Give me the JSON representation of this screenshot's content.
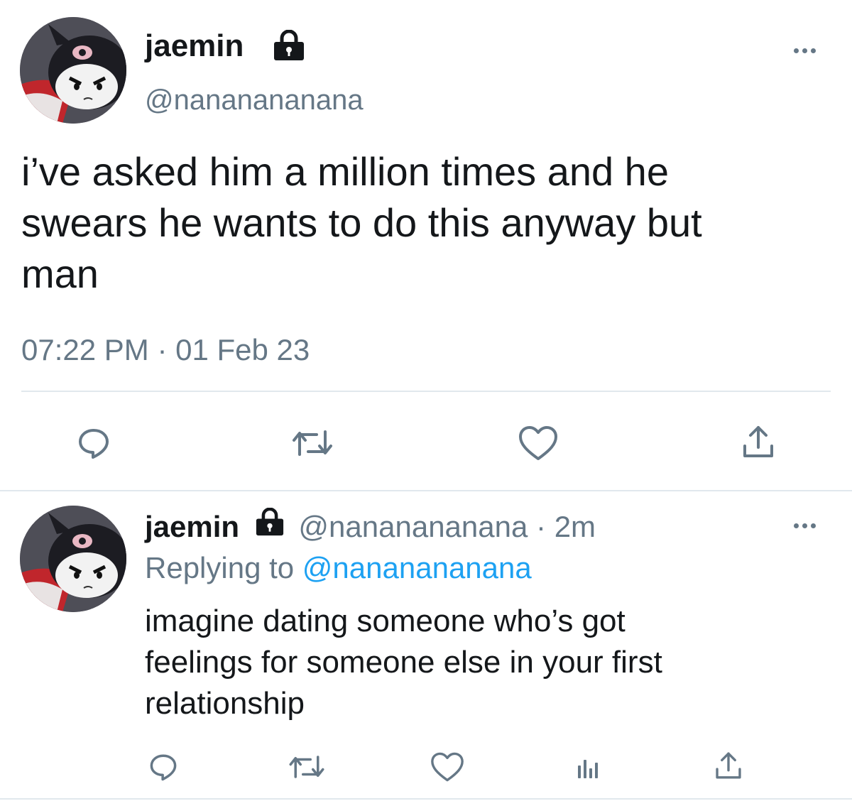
{
  "main_tweet": {
    "display_name": "jaemin",
    "handle": "@nananananana",
    "text_lines": [
      "i’ve asked him a million times and he",
      "swears he wants to do this anyway but",
      "man"
    ],
    "time": "07:22 PM",
    "separator": "·",
    "date": "01 Feb 23"
  },
  "reply_tweet": {
    "display_name": "jaemin",
    "handle": "@nananananana",
    "separator": "·",
    "age": "2m",
    "replying_prefix": "Replying to",
    "replying_handle": "@nananananana",
    "text_lines": [
      "imagine dating someone who’s got",
      "feelings for someone else in your first",
      "relationship"
    ]
  },
  "icons": {
    "lock": "lock-icon",
    "more": "more-options-icon",
    "reply": "reply-icon",
    "retweet": "retweet-icon",
    "like": "like-icon",
    "share": "share-icon",
    "analytics": "analytics-icon"
  },
  "colors": {
    "text": "#14171a",
    "secondary": "#657786",
    "link": "#1da1f2",
    "divider": "#e1e8ed"
  }
}
